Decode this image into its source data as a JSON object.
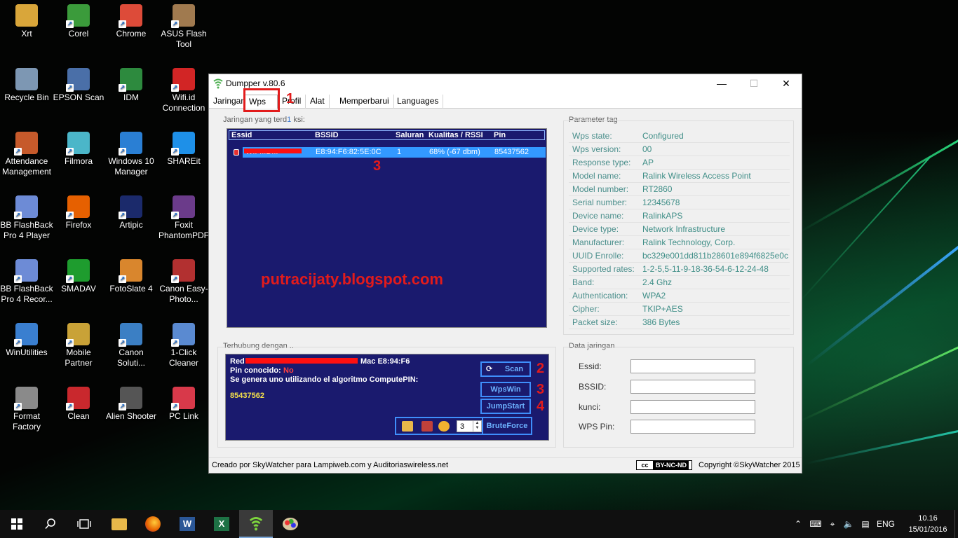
{
  "desktop": {
    "icons": [
      {
        "label": "Xrt",
        "icon": "folder-icon",
        "color": "#d9a63a"
      },
      {
        "label": "Corel",
        "icon": "corel-icon",
        "color": "#3b9b3b"
      },
      {
        "label": "Chrome",
        "icon": "chrome-icon",
        "color": "#dd4b39"
      },
      {
        "label": "ASUS Flash Tool",
        "icon": "asus-flash-tool-icon",
        "color": "#a07a4f"
      },
      {
        "label": "Recycle Bin",
        "icon": "recycle-bin-icon",
        "color": "#7d97b3"
      },
      {
        "label": "EPSON Scan",
        "icon": "epson-scan-icon",
        "color": "#4a6fa8"
      },
      {
        "label": "IDM",
        "icon": "idm-icon",
        "color": "#2d8a3e"
      },
      {
        "label": "Wifi.id Connection",
        "icon": "wifi-id-icon",
        "color": "#d22525"
      },
      {
        "label": "Attendance Management",
        "icon": "attendance-icon",
        "color": "#c65a2b"
      },
      {
        "label": "Filmora",
        "icon": "filmora-icon",
        "color": "#4bb6c9"
      },
      {
        "label": "Windows 10 Manager",
        "icon": "windows10-manager-icon",
        "color": "#2a7fd4"
      },
      {
        "label": "SHAREit",
        "icon": "shareit-icon",
        "color": "#1e90e8"
      },
      {
        "label": "BB FlashBack Pro 4 Player",
        "icon": "bb-flashback-player-icon",
        "color": "#6d8bd6"
      },
      {
        "label": "Firefox",
        "icon": "firefox-icon",
        "color": "#e66000"
      },
      {
        "label": "Artipic",
        "icon": "artipic-icon",
        "color": "#1b2a6b"
      },
      {
        "label": "Foxit PhantomPDF",
        "icon": "foxit-icon",
        "color": "#6b3b8a"
      },
      {
        "label": "BB FlashBack Pro 4 Recor...",
        "icon": "bb-flashback-recorder-icon",
        "color": "#6d8bd6"
      },
      {
        "label": "SMADAV",
        "icon": "smadav-icon",
        "color": "#1e9c2e"
      },
      {
        "label": "FotoSlate 4",
        "icon": "fotoslate-icon",
        "color": "#d9862d"
      },
      {
        "label": "Canon Easy-Photo...",
        "icon": "canon-easy-photo-icon",
        "color": "#b23030"
      },
      {
        "label": "WinUtilities",
        "icon": "winutilities-icon",
        "color": "#3a7fd0"
      },
      {
        "label": "Mobile Partner",
        "icon": "mobile-partner-icon",
        "color": "#c9a237"
      },
      {
        "label": "Canon Soluti...",
        "icon": "canon-solution-icon",
        "color": "#3b7fc4"
      },
      {
        "label": "1-Click Cleaner",
        "icon": "one-click-cleaner-icon",
        "color": "#5a8ad1"
      },
      {
        "label": "Format Factory",
        "icon": "format-factory-icon",
        "color": "#8a8a8a"
      },
      {
        "label": "Clean",
        "icon": "ccleaner-icon",
        "color": "#c9282d"
      },
      {
        "label": "Alien Shooter",
        "icon": "alien-shooter-icon",
        "color": "#555555"
      },
      {
        "label": "PC Link",
        "icon": "pc-link-icon",
        "color": "#d8394a"
      }
    ]
  },
  "window": {
    "title": "Dumpper v.80.6",
    "minimize": "—",
    "maximize": "☐",
    "close": "✕",
    "tabs": [
      {
        "label": "Jaringan"
      },
      {
        "label": "Wps"
      },
      {
        "label": "Profil"
      },
      {
        "label": "Alat"
      },
      {
        "label": "Memperbarui"
      },
      {
        "label": "Languages"
      }
    ],
    "networks_label_part1": "Jaringan yang terd",
    "networks_label_count": "1",
    "networks_label_part2": "ksi:",
    "columns": [
      "Essid",
      "BSSID",
      "Saluran",
      "Kualitas / RSSI",
      "Pin"
    ],
    "network_row": {
      "essid": "WIFI.ID...",
      "bssid": "E8:94:F6:82:5E:0C",
      "channel": "1",
      "quality": "68% (-67 dbm)",
      "pin": "85437562"
    },
    "watermark": "putracijaty.blogspot.com",
    "annotations": {
      "a1": "1",
      "a2": "2",
      "a3": "3",
      "a3b": "3",
      "a4": "4"
    },
    "params_label": "Parameter tag",
    "params": [
      {
        "key": "Wps state:",
        "value": "Configured"
      },
      {
        "key": "Wps version:",
        "value": "00"
      },
      {
        "key": "Response type:",
        "value": "AP"
      },
      {
        "key": "Model name:",
        "value": "Ralink Wireless Access Point"
      },
      {
        "key": "Model number:",
        "value": "RT2860"
      },
      {
        "key": "Serial number:",
        "value": "12345678"
      },
      {
        "key": "Device name:",
        "value": "RalinkAPS"
      },
      {
        "key": "Device type:",
        "value": "Network Infrastructure"
      },
      {
        "key": "Manufacturer:",
        "value": "Ralink Technology, Corp."
      },
      {
        "key": "UUID Enrolle:",
        "value": "bc329e001dd811b28601e894f6825e0c"
      },
      {
        "key": "Supported rates:",
        "value": "1-2-5,5-11-9-18-36-54-6-12-24-48"
      },
      {
        "key": "Band:",
        "value": "2.4 Ghz"
      },
      {
        "key": "Authentication:",
        "value": "WPA2"
      },
      {
        "key": "Cipher:",
        "value": "TKIP+AES"
      },
      {
        "key": "Packet size:",
        "value": "386 Bytes"
      }
    ],
    "connected_label": "Terhubung dengan ..",
    "conn": {
      "red_prefix": "Red",
      "mac_text": "Mac E8:94:F6",
      "pin_known_label": "Pin conocido:",
      "pin_known_value": "No",
      "generated_text": "Se genera uno utilizando el algoritmo ComputePIN:",
      "pin": "85437562"
    },
    "buttons": {
      "scan": "Scan",
      "wpswin": "WpsWin",
      "jumpstart": "JumpStart",
      "bruteforce": "BruteForce"
    },
    "spin_value": "3",
    "data_label": "Data jaringan",
    "fields": [
      {
        "label": "Essid:",
        "value": ""
      },
      {
        "label": "BSSID:",
        "value": ""
      },
      {
        "label": "kunci:",
        "value": ""
      },
      {
        "label": "WPS Pin:",
        "value": ""
      }
    ],
    "status_left": "Creado por SkyWatcher para Lampiweb.com y Auditoriaswireless.net",
    "cc_badge": "cc",
    "cc_license": "BY-NC-ND",
    "status_right": "Copyright ©SkyWatcher 2015"
  },
  "taskbar": {
    "language": "ENG",
    "time": "10.16",
    "date": "15/01/2016"
  },
  "colors": {
    "panel_bg": "#1a1a6e",
    "selection": "#3399ff",
    "annotation": "#e21b1b",
    "param_text": "#3f8e87"
  }
}
